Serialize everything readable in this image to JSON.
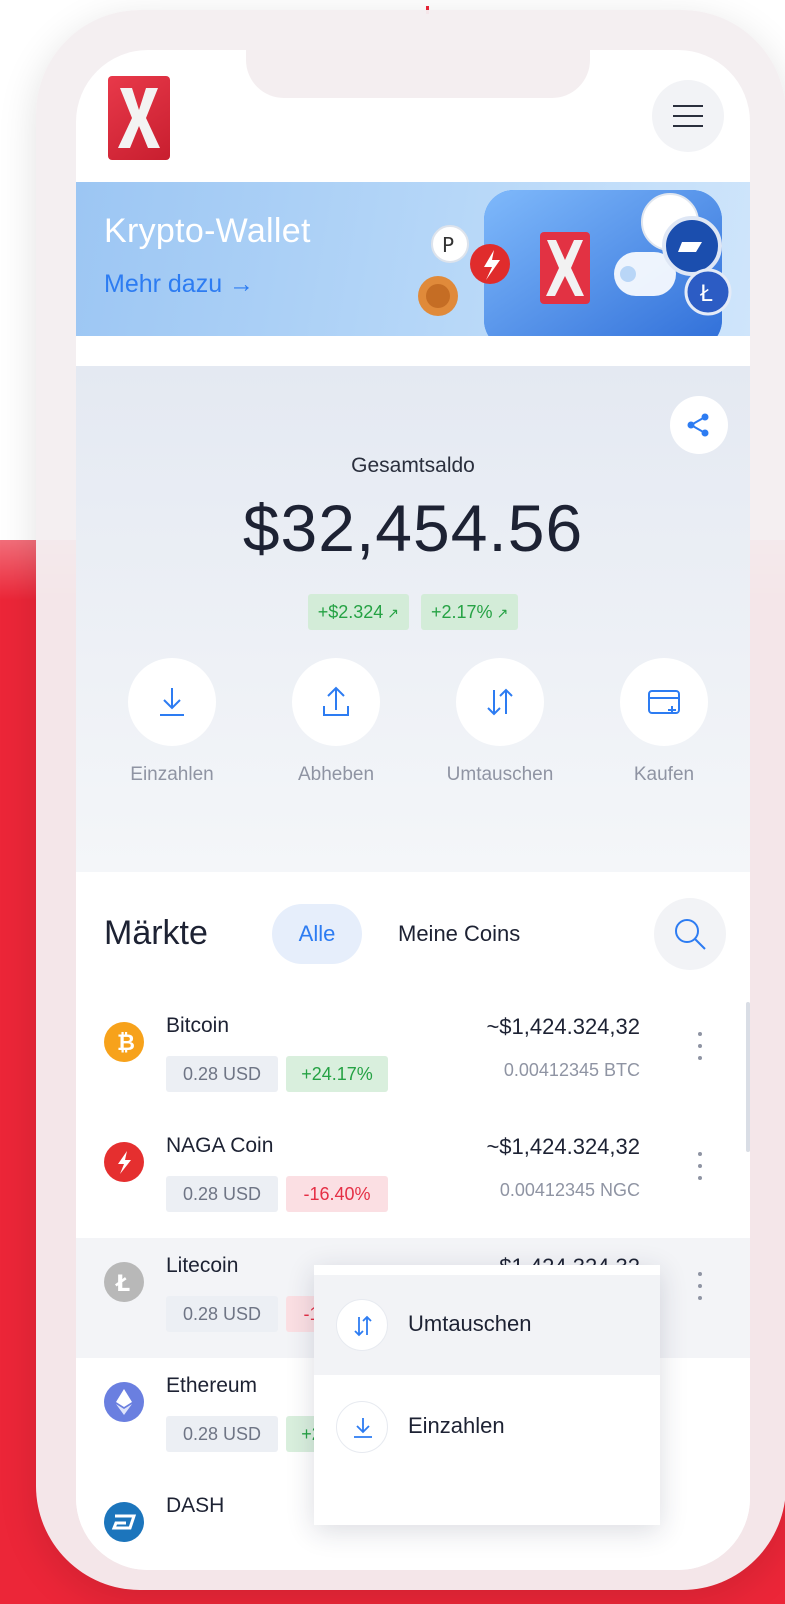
{
  "header": {
    "logo_letter": "X",
    "menu_icon": "hamburger-menu-icon"
  },
  "banner": {
    "title": "Krypto-Wallet",
    "link_label": "Mehr dazu →"
  },
  "balance": {
    "label": "Gesamtsaldo",
    "value": "$32,454.56",
    "change_abs": "+$2.324",
    "change_pct": "+2.17%",
    "trend_icon": "↗"
  },
  "actions": [
    {
      "label": "Einzahlen",
      "icon": "download-icon"
    },
    {
      "label": "Abheben",
      "icon": "upload-icon"
    },
    {
      "label": "Umtauschen",
      "icon": "swap-icon"
    },
    {
      "label": "Kaufen",
      "icon": "card-add-icon"
    }
  ],
  "markets": {
    "title": "Märkte",
    "tabs": [
      {
        "label": "Alle",
        "active": true
      },
      {
        "label": "Meine Coins",
        "active": false
      }
    ],
    "coins": [
      {
        "name": "Bitcoin",
        "price": "0.28 USD",
        "change": "+24.17%",
        "value": "~$1,424.324,32",
        "amount": "0.00412345 BTC",
        "icon_color": "#f7a21b"
      },
      {
        "name": "NAGA Coin",
        "price": "0.28 USD",
        "change": "-16.40%",
        "value": "~$1,424.324,32",
        "amount": "0.00412345 NGC",
        "icon_color": "#e52f2f"
      },
      {
        "name": "Litecoin",
        "price": "0.28 USD",
        "change": "-16.40%",
        "value": "~$1,424.324,32",
        "amount": "",
        "icon_color": "#b8b8b8"
      },
      {
        "name": "Ethereum",
        "price": "0.28 USD",
        "change": "+24.17%",
        "value": "",
        "amount": "",
        "icon_color": "#6a7fe0"
      },
      {
        "name": "DASH",
        "price": "",
        "change": "",
        "value": "",
        "amount": "",
        "icon_color": "#1c75bc"
      }
    ]
  },
  "context_menu": {
    "items": [
      {
        "label": "Umtauschen",
        "icon": "swap-icon"
      },
      {
        "label": "Einzahlen",
        "icon": "download-icon"
      }
    ]
  },
  "colors": {
    "accent_red": "#ec2638",
    "accent_blue": "#2d7cf2",
    "positive": "#25a244",
    "negative": "#e52f45"
  }
}
